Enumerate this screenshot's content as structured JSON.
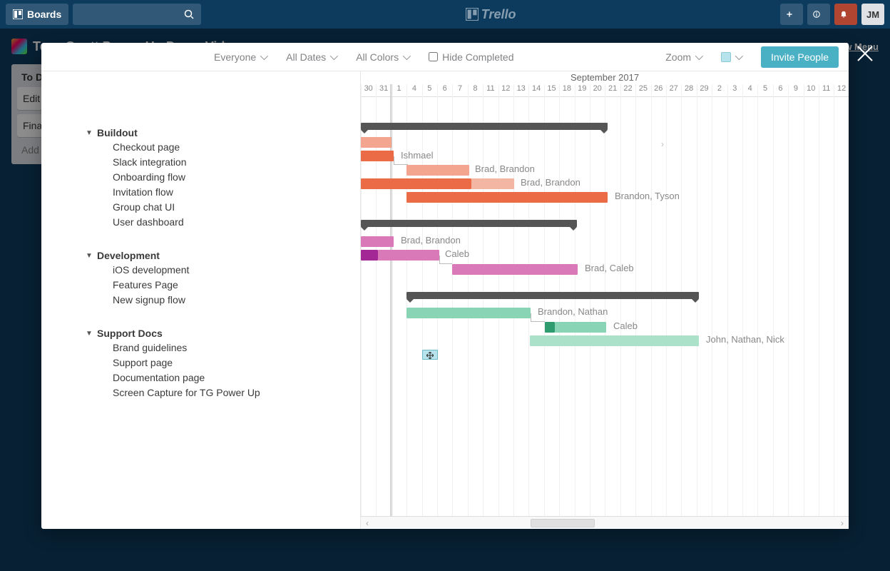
{
  "trello": {
    "boards_label": "Boards",
    "logo_text": "Trello",
    "avatar": "JM",
    "show_menu": "Show Menu",
    "board_title": "TeamGantt Power-Up Demo Video",
    "list_title": "To Do",
    "card1": "Edit T",
    "card2": "Final",
    "add_card": "Add a"
  },
  "toolbar": {
    "everyone": "Everyone",
    "all_dates": "All Dates",
    "all_colors": "All Colors",
    "hide_completed": "Hide Completed",
    "zoom": "Zoom",
    "invite": "Invite People"
  },
  "month": "September 2017",
  "days": [
    "30",
    "31",
    "1",
    "4",
    "5",
    "6",
    "7",
    "8",
    "11",
    "12",
    "13",
    "14",
    "15",
    "18",
    "19",
    "20",
    "21",
    "22",
    "25",
    "26",
    "27",
    "28",
    "29",
    "2",
    "3",
    "4",
    "5",
    "6",
    "9",
    "10",
    "11",
    "12"
  ],
  "groups": [
    {
      "name": "Buildout",
      "tasks": [
        "Checkout page",
        "Slack integration",
        "Onboarding flow",
        "Invitation flow",
        "Group chat UI",
        "User dashboard"
      ]
    },
    {
      "name": "Development",
      "tasks": [
        "iOS development",
        "Features Page",
        "New signup flow"
      ]
    },
    {
      "name": "Support Docs",
      "tasks": [
        "Brand guidelines",
        "Support page",
        "Documentation page",
        "Screen Capture for TG Power Up"
      ]
    }
  ],
  "bar_labels": {
    "ishmael": "Ishmael",
    "brad_brandon1": "Brad, Brandon",
    "brad_brandon2": "Brad, Brandon",
    "brandon_tyson": "Brandon, Tyson",
    "brad_brandon3": "Brad, Brandon",
    "caleb1": "Caleb",
    "brad_caleb": "Brad, Caleb",
    "brandon_nathan": "Brandon, Nathan",
    "caleb2": "Caleb",
    "john_nathan_nick": "John, Nathan, Nick"
  },
  "chart_data": {
    "type": "gantt",
    "month": "September 2017",
    "visible_day_sequence": [
      "Aug 30",
      "Aug 31",
      "Sep 1",
      "Sep 4",
      "Sep 5",
      "Sep 6",
      "Sep 7",
      "Sep 8",
      "Sep 11",
      "Sep 12",
      "Sep 13",
      "Sep 14",
      "Sep 15",
      "Sep 18",
      "Sep 19",
      "Sep 20",
      "Sep 21",
      "Sep 22",
      "Sep 25",
      "Sep 26",
      "Sep 27",
      "Sep 28",
      "Sep 29",
      "Oct 2",
      "Oct 3",
      "Oct 4",
      "Oct 5",
      "Oct 6",
      "Oct 9",
      "Oct 10",
      "Oct 11",
      "Oct 12"
    ],
    "groups": [
      {
        "name": "Buildout",
        "summary_bar": {
          "start": "Aug 30",
          "end": "Sep 20"
        },
        "tasks": [
          {
            "name": "Checkout page",
            "start": "Aug 30",
            "end": "Aug 31"
          },
          {
            "name": "Slack integration",
            "start": "Aug 30",
            "end": "Sep 1",
            "assignees": "Ishmael"
          },
          {
            "name": "Onboarding flow",
            "start": "Sep 4",
            "end": "Sep 8",
            "assignees": "Brad, Brandon"
          },
          {
            "name": "Invitation flow",
            "segments": [
              {
                "start": "Aug 30",
                "end": "Sep 8"
              },
              {
                "start": "Sep 8",
                "end": "Sep 13",
                "light": true
              }
            ],
            "assignees": "Brad, Brandon"
          },
          {
            "name": "Group chat UI",
            "bar": null
          },
          {
            "name": "User dashboard",
            "start": "Sep 4",
            "end": "Sep 20",
            "assignees": "Brandon, Tyson"
          }
        ]
      },
      {
        "name": "Development",
        "summary_bar": {
          "start": "Aug 30",
          "end": "Sep 18"
        },
        "tasks": [
          {
            "name": "iOS development",
            "start": "Aug 30",
            "end": "Sep 1",
            "assignees": "Brad, Brandon"
          },
          {
            "name": "Features Page",
            "segments": [
              {
                "start": "Aug 30",
                "end": "Aug 31",
                "dark": true
              },
              {
                "start": "Aug 31",
                "end": "Sep 6"
              }
            ],
            "assignees": "Caleb"
          },
          {
            "name": "New signup flow",
            "start": "Sep 7",
            "end": "Sep 18",
            "assignees": "Brad, Caleb"
          }
        ]
      },
      {
        "name": "Support Docs",
        "summary_bar": {
          "start": "Sep 4",
          "end": "Sep 29"
        },
        "tasks": [
          {
            "name": "Brand guidelines",
            "start": "Sep 4",
            "end": "Sep 14",
            "assignees": "Brandon, Nathan"
          },
          {
            "name": "Support page",
            "segments": [
              {
                "start": "Sep 15",
                "end": "Sep 15",
                "dark": true
              },
              {
                "start": "Sep 15",
                "end": "Sep 20"
              }
            ],
            "assignees": "Caleb"
          },
          {
            "name": "Documentation page",
            "start": "Sep 14",
            "end": "Sep 29",
            "assignees": "John, Nathan, Nick"
          },
          {
            "name": "Screen Capture for TG Power Up",
            "start": "Sep 5",
            "end": "Sep 6"
          }
        ]
      }
    ]
  }
}
